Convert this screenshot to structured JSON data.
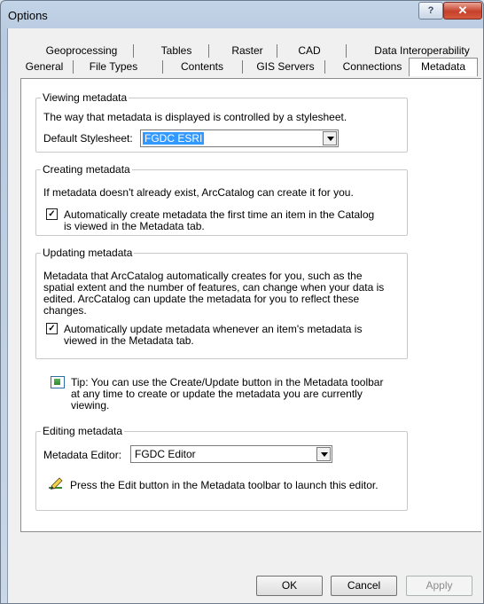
{
  "window": {
    "title": "Options",
    "help_glyph": "?",
    "close_glyph": "✕"
  },
  "tabs": {
    "row1": [
      "Geoprocessing",
      "Tables",
      "Raster",
      "CAD",
      "Data Interoperability"
    ],
    "row2": [
      "General",
      "File Types",
      "Contents",
      "GIS Servers",
      "Connections",
      "Metadata"
    ],
    "active": "Metadata"
  },
  "viewing": {
    "legend": "Viewing metadata",
    "description": "The way that metadata is displayed is controlled by a stylesheet.",
    "stylesheet_label": "Default Stylesheet:",
    "stylesheet_value": "FGDC ESRI"
  },
  "creating": {
    "legend": "Creating metadata",
    "description": "If metadata doesn't already exist, ArcCatalog can create it for you.",
    "checkbox_line1": "Automatically create metadata the first time an item in the Catalog",
    "checkbox_line2": "is viewed in the Metadata tab.",
    "checked": true
  },
  "updating": {
    "legend": "Updating metadata",
    "desc_line1": "Metadata that ArcCatalog automatically creates for you, such as the",
    "desc_line2": "spatial extent and the number of features, can change when your data is",
    "desc_line3": "edited.  ArcCatalog can update the metadata for you to reflect these",
    "desc_line4": "changes.",
    "checkbox_line1": "Automatically update metadata whenever an item's metadata is",
    "checkbox_line2": "viewed in the Metadata tab.",
    "checked": true
  },
  "tip": {
    "line1": "Tip: You can use the Create/Update button in the Metadata toolbar",
    "line2": "at any time to create or update the metadata you are currently",
    "line3": "viewing."
  },
  "editing": {
    "legend": "Editing metadata",
    "editor_label": "Metadata Editor:",
    "editor_value": "FGDC Editor",
    "hint": "Press the Edit button in the Metadata toolbar to launch this editor."
  },
  "buttons": {
    "ok": "OK",
    "cancel": "Cancel",
    "apply": "Apply"
  },
  "colors": {
    "selection": "#3399ff",
    "close_red": "#c7402b",
    "frame": "#c3d4e8"
  }
}
